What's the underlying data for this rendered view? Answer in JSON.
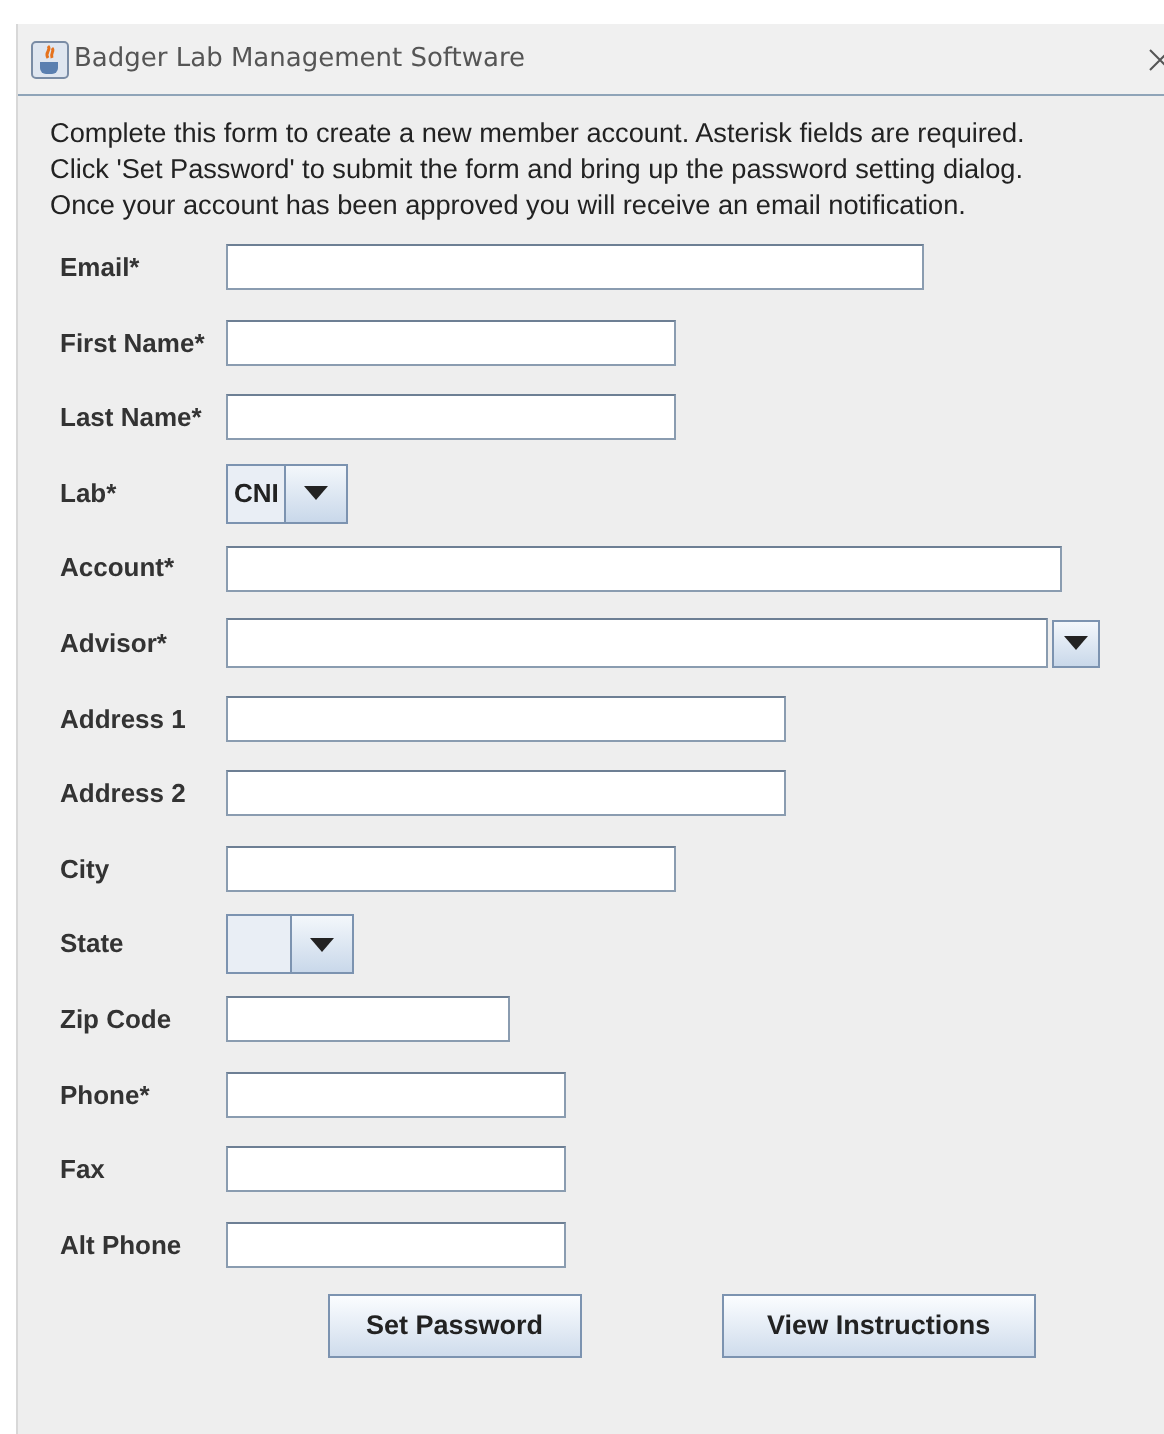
{
  "window": {
    "title": "Badger Lab Management Software"
  },
  "intro": [
    "Complete this form to create a new member account. Asterisk fields are required.",
    "Click 'Set Password' to submit the form and bring up the password setting dialog.",
    "Once your account has been approved you will receive an email notification."
  ],
  "fields": [
    {
      "label": "Email*",
      "kind": "text"
    },
    {
      "label": "First Name*",
      "kind": "text"
    },
    {
      "label": "Last Name*",
      "kind": "text"
    },
    {
      "label": "Lab*",
      "kind": "combo",
      "value": "CNI"
    },
    {
      "label": "Account*",
      "kind": "text"
    },
    {
      "label": "Advisor*",
      "kind": "editable-combo"
    },
    {
      "label": "Address 1",
      "kind": "text"
    },
    {
      "label": "Address 2",
      "kind": "text"
    },
    {
      "label": "City",
      "kind": "text"
    },
    {
      "label": "State",
      "kind": "combo"
    },
    {
      "label": "Zip Code",
      "kind": "text"
    },
    {
      "label": "Phone*",
      "kind": "text"
    },
    {
      "label": "Fax",
      "kind": "text"
    },
    {
      "label": "Alt Phone",
      "kind": "text"
    }
  ],
  "buttons": [
    "Set Password",
    "View Instructions"
  ]
}
